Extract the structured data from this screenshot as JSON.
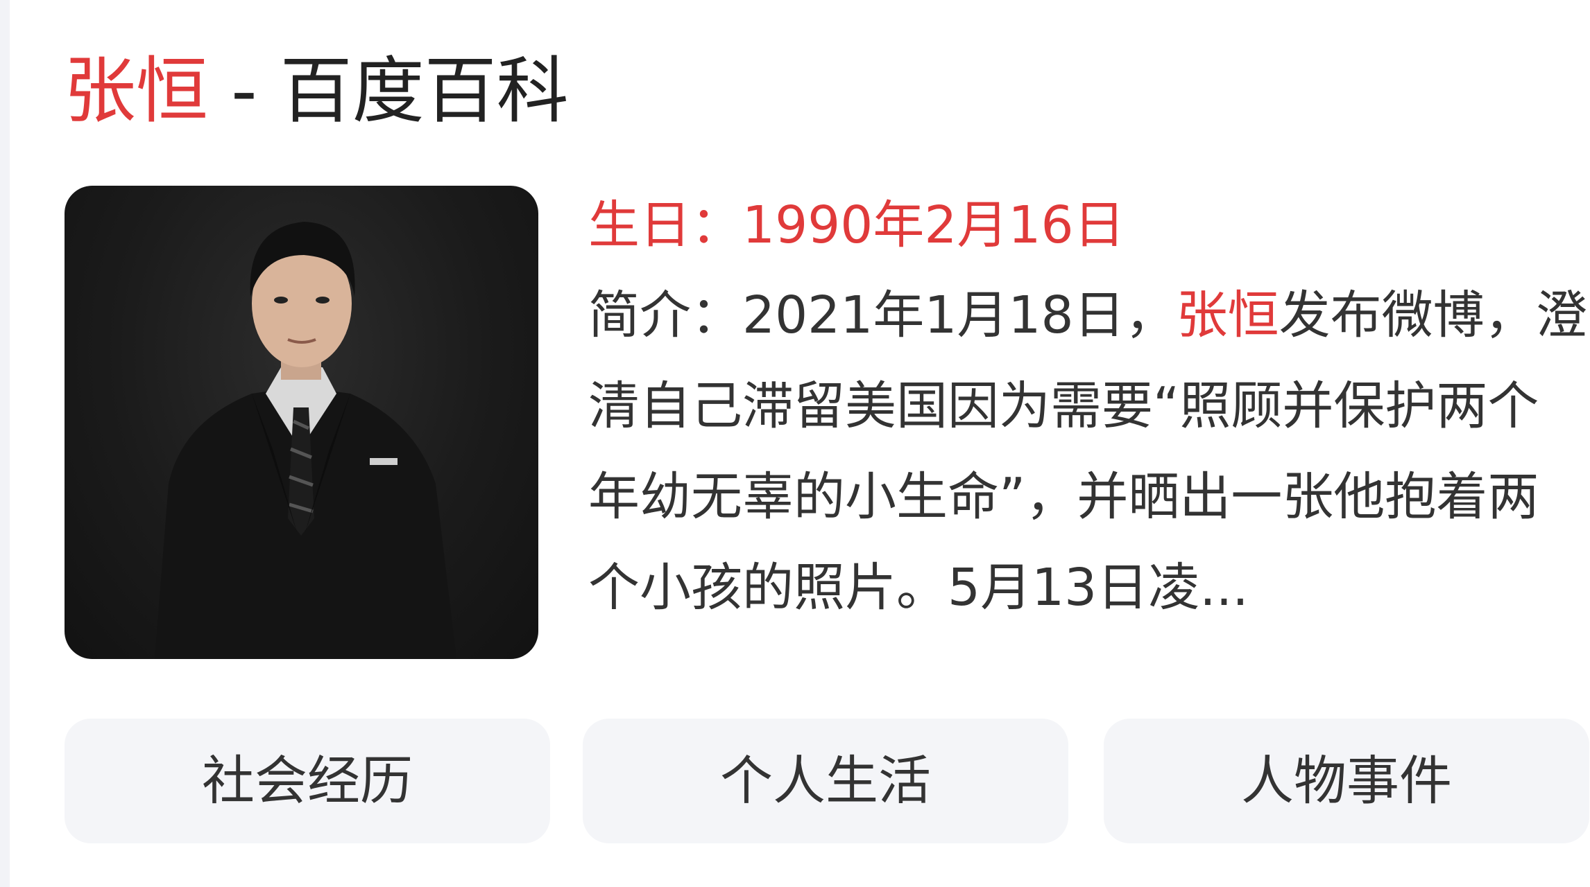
{
  "header": {
    "title_keyword": "张恒",
    "title_rest": " - 百度百科"
  },
  "profile": {
    "photo_label": "person-photo",
    "birthday_label": "生日：",
    "birthday_value": "1990年2月16日",
    "summary_label": "简介：",
    "summary_part1": "2021年1月18日，",
    "summary_keyword": "张恒",
    "summary_part2": "发布微博，澄清自己滞留美国因为需要“照顾并保护两个年幼无辜的小生命”，并晒出一张他抱着两个小孩的照片。5月13日凌..."
  },
  "tabs": [
    {
      "label": "社会经历"
    },
    {
      "label": "个人生活"
    },
    {
      "label": "人物事件"
    }
  ],
  "colors": {
    "keyword": "#e03a3a",
    "text": "#333333",
    "tab_bg": "#f4f5f8"
  }
}
